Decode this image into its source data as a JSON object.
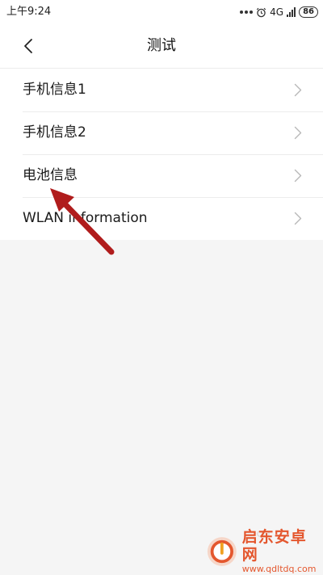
{
  "status_bar": {
    "time": "上午9:24",
    "network": "4G",
    "battery": "86"
  },
  "header": {
    "title": "测试"
  },
  "list": {
    "items": [
      {
        "label": "手机信息1"
      },
      {
        "label": "手机信息2"
      },
      {
        "label": "电池信息"
      },
      {
        "label": "WLAN information"
      }
    ]
  },
  "watermark": {
    "name": "启东安卓网",
    "url": "www.qdltdq.com"
  },
  "colors": {
    "annotation_arrow": "#b01c1c",
    "watermark": "#e4572e"
  }
}
